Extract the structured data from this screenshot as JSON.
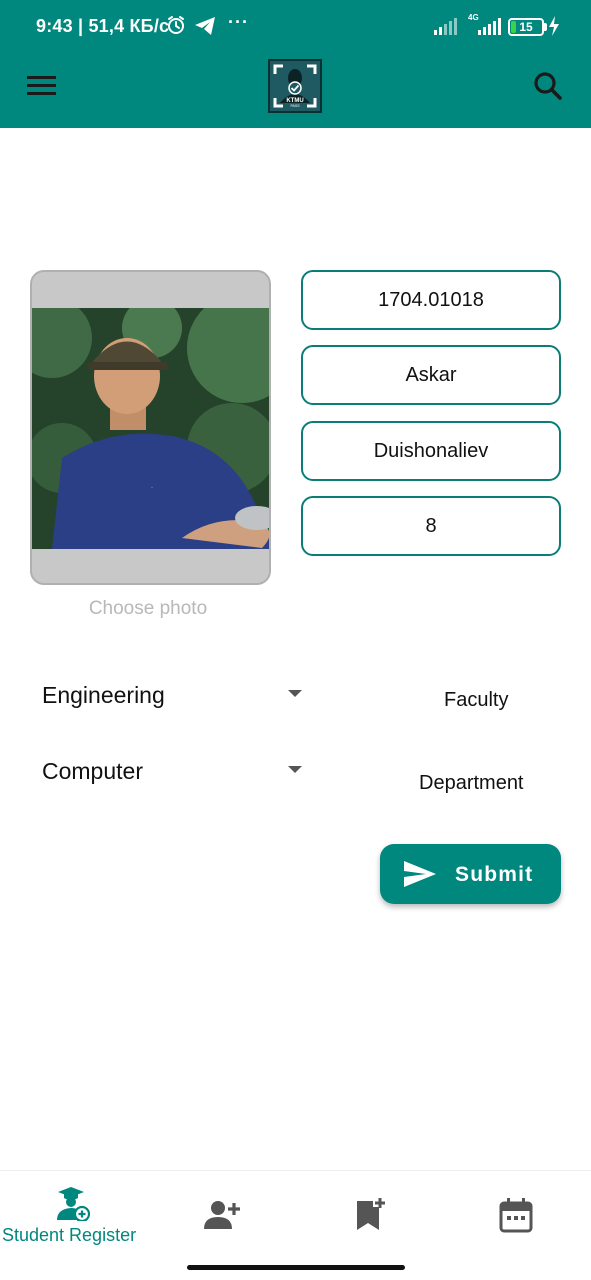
{
  "status_bar": {
    "time_speed": "9:43 | 51,4 КБ/с",
    "more": "···",
    "network": "4G",
    "battery": "15",
    "battery_level": 0.15
  },
  "app_bar": {
    "menu_icon": "menu-icon",
    "logo_text": "KTMU",
    "logo_subtext": "PASS",
    "search_icon": "search-icon"
  },
  "photo": {
    "choose_label": "Choose photo"
  },
  "fields": {
    "student_id": "1704.01018",
    "first_name": "Askar",
    "last_name": "Duishonaliev",
    "year": "8"
  },
  "faculty": {
    "selected": "Engineering",
    "label": "Faculty"
  },
  "department": {
    "selected": "Computer",
    "label": "Department"
  },
  "submit": {
    "label": "Submit",
    "icon": "send-icon"
  },
  "bottom_nav": {
    "items": [
      {
        "label": "Student Register",
        "icon": "student-register-icon",
        "active": true
      },
      {
        "label": "",
        "icon": "person-add-icon",
        "active": false
      },
      {
        "label": "",
        "icon": "bookmark-add-icon",
        "active": false
      },
      {
        "label": "",
        "icon": "calendar-icon",
        "active": false
      }
    ]
  },
  "colors": {
    "primary": "#00877e",
    "border": "#0a7d76",
    "inactive_icon": "#555555",
    "hint_text": "#b8b8b8"
  }
}
